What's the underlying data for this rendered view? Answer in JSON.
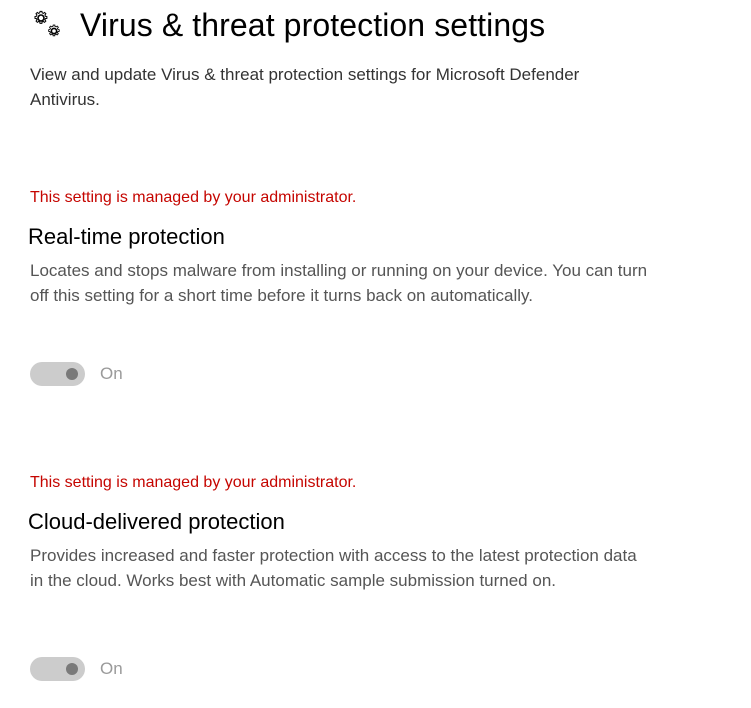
{
  "header": {
    "icon": "gears-icon",
    "title": "Virus & threat protection settings",
    "description": "View and update Virus & threat protection settings for Microsoft Defender Antivirus."
  },
  "settings": [
    {
      "admin_note": "This setting is managed by your administrator.",
      "title": "Real-time protection",
      "description": "Locates and stops malware from installing or running on your device. You can turn off this setting for a short time before it turns back on automatically.",
      "toggle_state": "On",
      "toggle_enabled": false
    },
    {
      "admin_note": "This setting is managed by your administrator.",
      "title": "Cloud-delivered protection",
      "description": "Provides increased and faster protection with access to the latest protection data in the cloud. Works best with Automatic sample submission turned on.",
      "toggle_state": "On",
      "toggle_enabled": false
    }
  ],
  "colors": {
    "admin_note": "#c50500",
    "toggle_track_disabled": "#cccccc",
    "toggle_knob_disabled": "#7a7a7a",
    "toggle_label_disabled": "#9a9a9a"
  }
}
